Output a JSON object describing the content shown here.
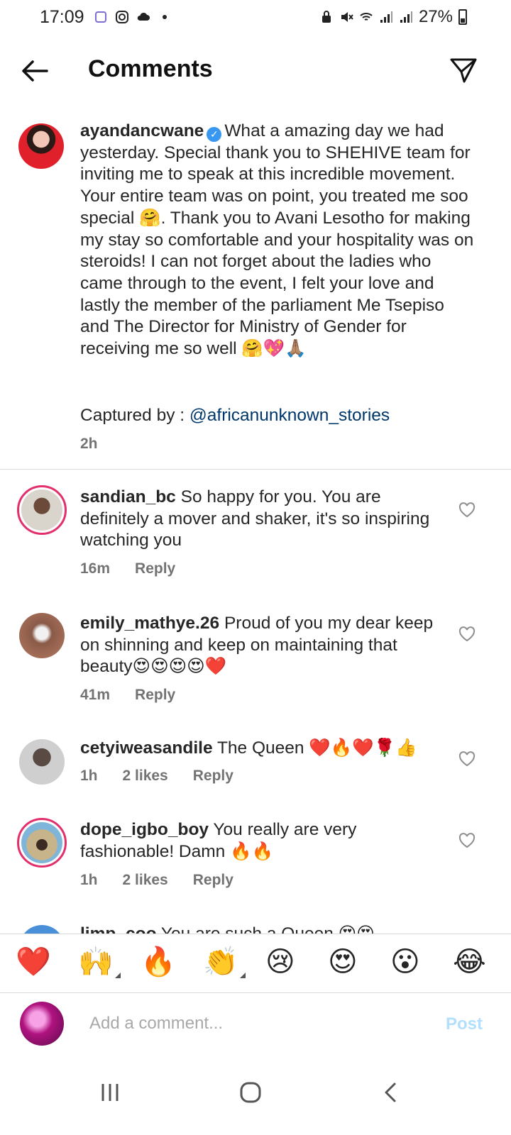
{
  "status_bar": {
    "time": "17:09",
    "battery": "27%"
  },
  "header": {
    "title": "Comments"
  },
  "caption": {
    "username": "ayandancwane",
    "text": "What a amazing day we had yesterday. Special thank you to SHEHIVE team for inviting me to speak at this incredible movement. Your entire team was on point, you treated me soo special 🤗. Thank you to Avani Lesotho for making my stay so comfortable and your hospitality was on steroids!  I can not forget about the ladies who came through to the event, I felt your love and lastly the member of the parliament Me Tsepiso and The Director for Ministry of Gender for receiving me so well 🤗💖🙏🏽",
    "credit_label": "Captured by : ",
    "credit_mention": "@africanunknown_stories",
    "time": "2h"
  },
  "comments": [
    {
      "username": "sandian_bc",
      "text": "So happy for you. You are definitely a mover and shaker, it's so inspiring watching you",
      "time": "16m",
      "likes": "",
      "reply": "Reply"
    },
    {
      "username": "emily_mathye.26",
      "text": "Proud of you my dear keep on shinning and keep on maintaining that beauty😍😍😍😍❤️",
      "time": "41m",
      "likes": "",
      "reply": "Reply"
    },
    {
      "username": "cetyiweasandile",
      "text": "The Queen ❤️🔥❤️🌹👍",
      "time": "1h",
      "likes": "2 likes",
      "reply": "Reply"
    },
    {
      "username": "dope_igbo_boy",
      "text": "You really are very fashionable! Damn 🔥🔥",
      "time": "1h",
      "likes": "2 likes",
      "reply": "Reply"
    }
  ],
  "partial_comment": {
    "username": "limp_coo",
    "text": "You are such a Queen 😍😍"
  },
  "emoji_bar": [
    "❤️",
    "🙌",
    "🔥",
    "👏",
    "😢",
    "😍",
    "😮",
    "😂"
  ],
  "input": {
    "placeholder": "Add a comment...",
    "post_label": "Post"
  },
  "colors": {
    "link": "#00376b",
    "verified": "#3897f0",
    "post_disabled": "#b2dffc",
    "secondary_text": "#737373"
  }
}
